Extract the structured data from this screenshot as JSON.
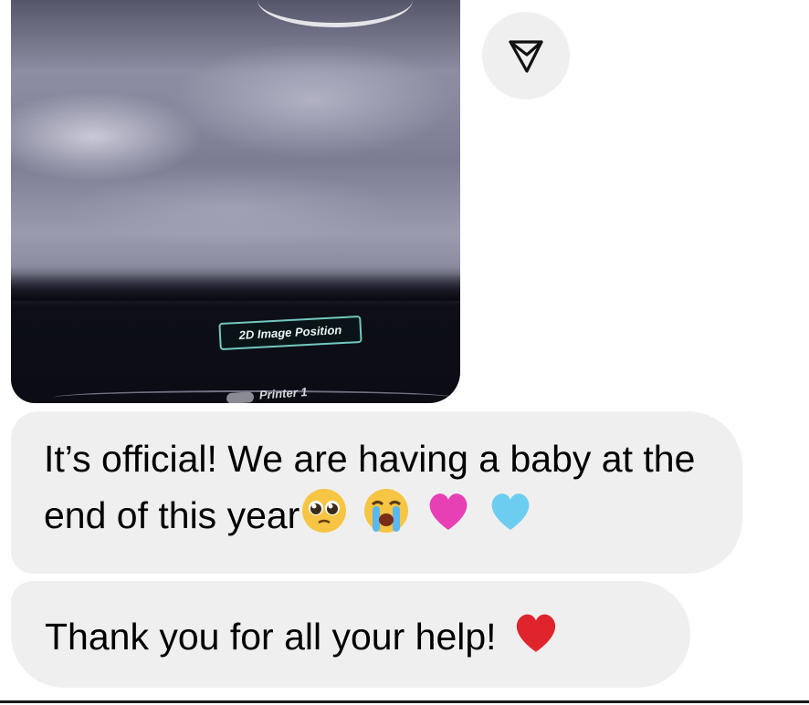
{
  "attachment": {
    "overlay_label": "2D Image Position",
    "printer_label": "Printer 1"
  },
  "messages": [
    {
      "text": "It’s official! We are having a baby at the end of this year",
      "emoji": [
        "pleading-face",
        "loudly-crying-face",
        "pink-heart",
        "light-blue-heart"
      ]
    },
    {
      "text": "Thank you for all your help!",
      "emoji": [
        "red-heart"
      ]
    }
  ],
  "icons": {
    "share": "paper-plane-icon"
  },
  "colors": {
    "bubble": "#efefef",
    "text": "#000000",
    "background": "#ffffff"
  }
}
